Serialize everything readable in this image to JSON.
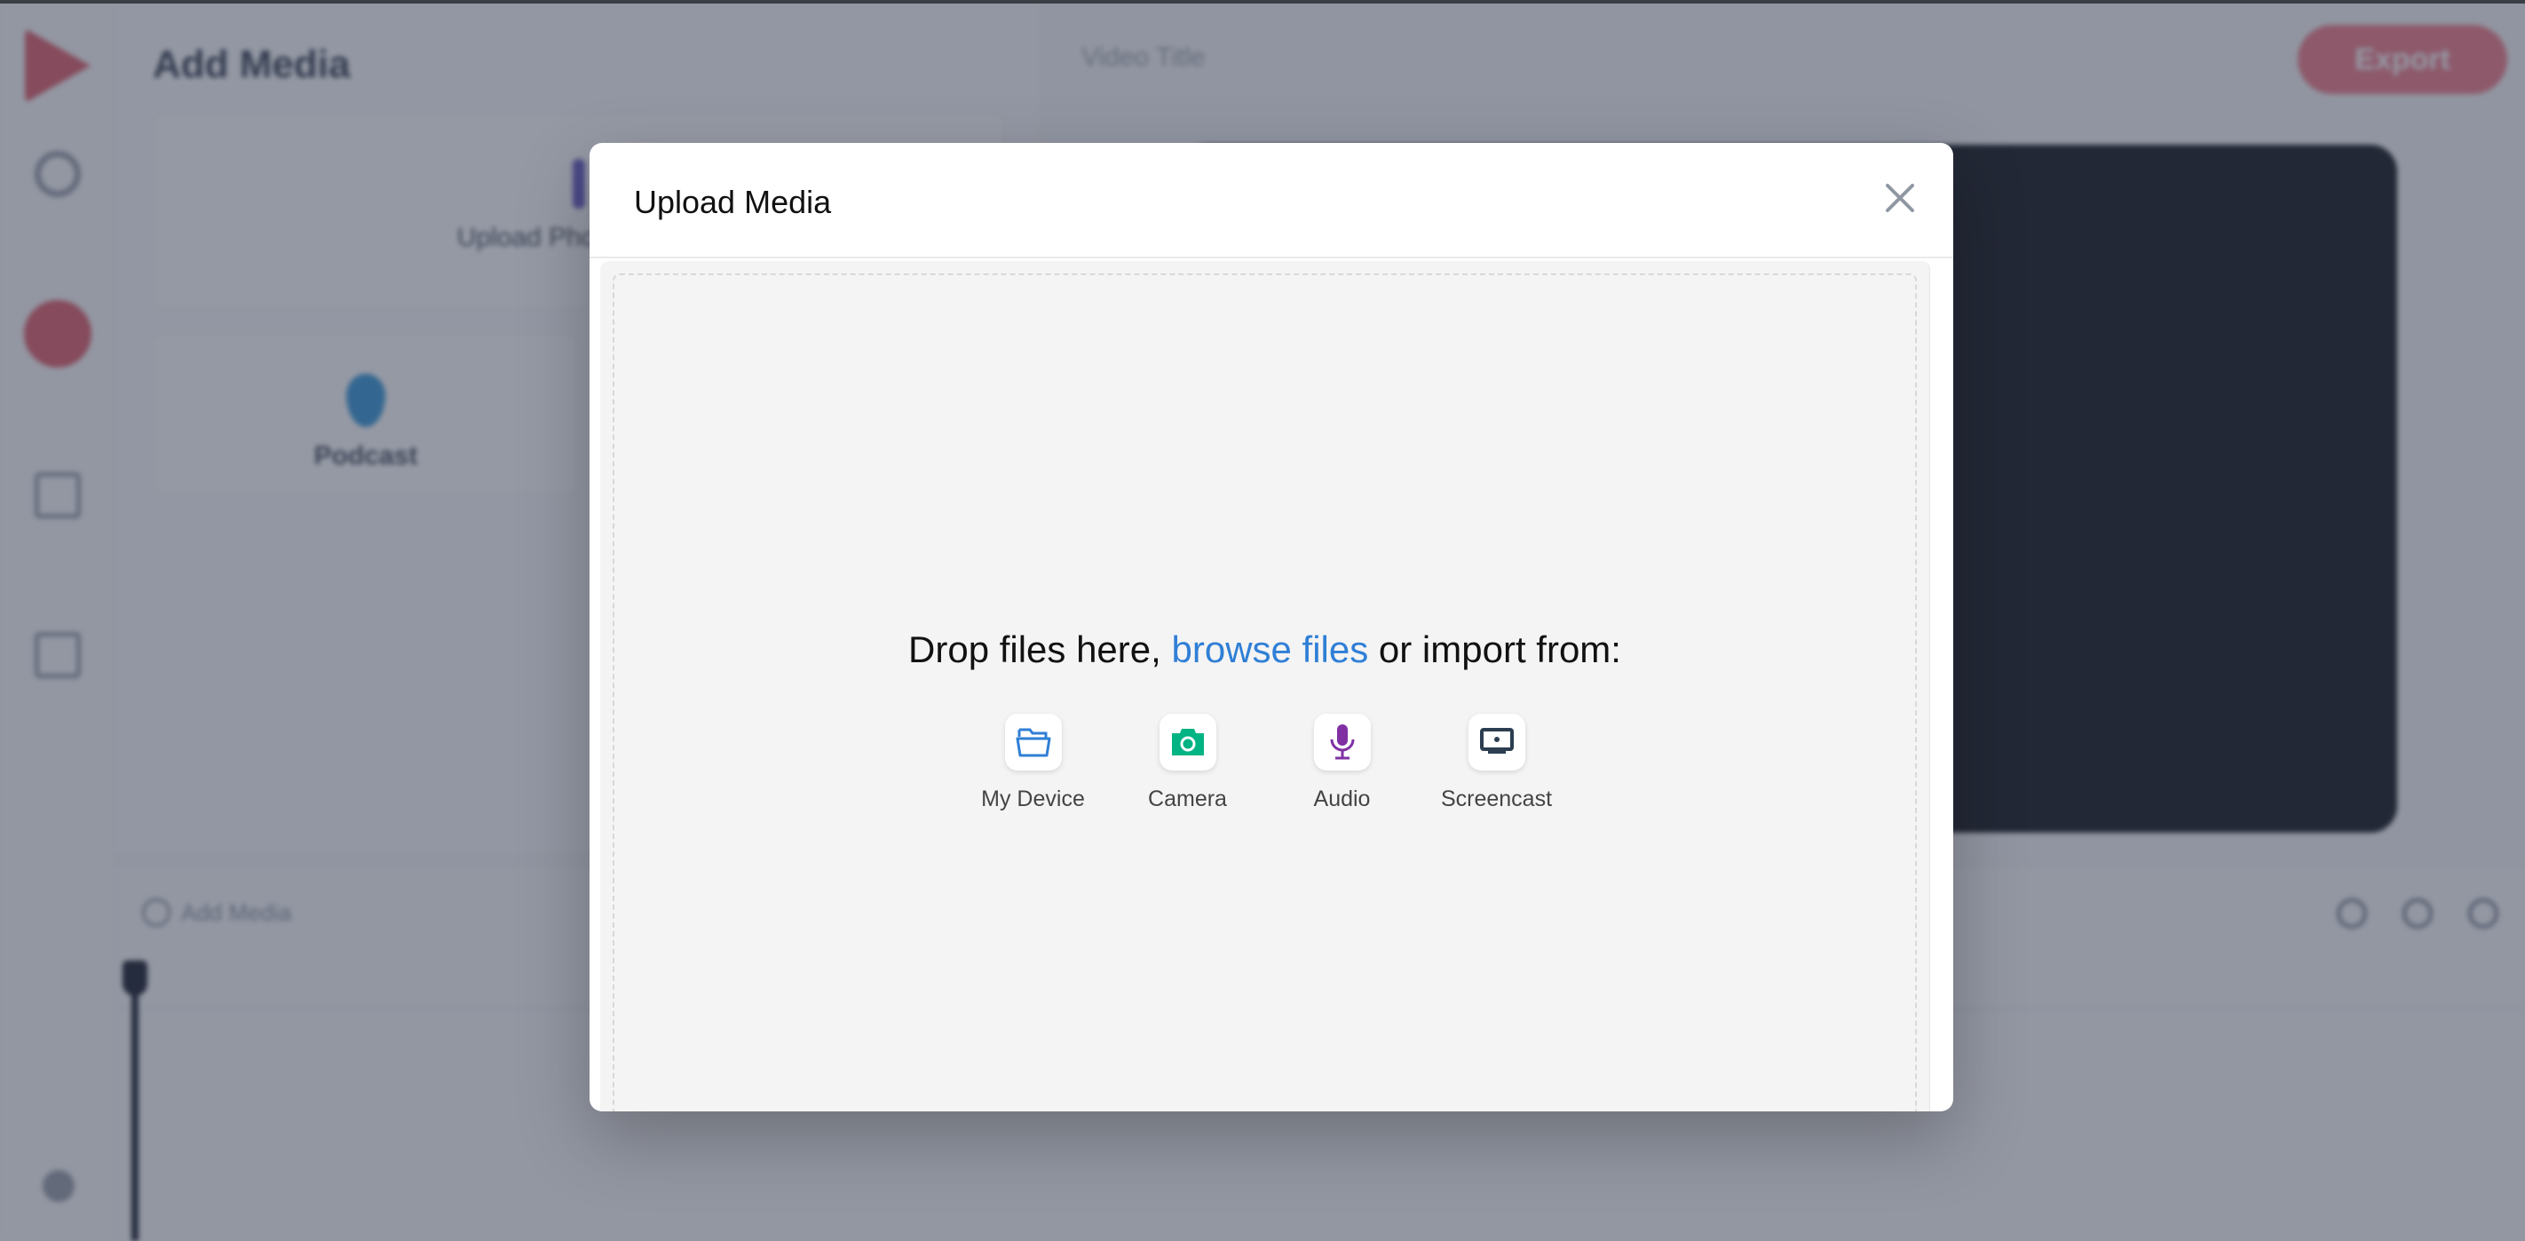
{
  "background": {
    "panel_title": "Add Media",
    "cards": [
      {
        "label": "Upload Photo, Video"
      },
      {
        "label": "Podcast"
      }
    ],
    "video_title": "Video Title",
    "export_label": "Export",
    "timeline": {
      "add_media_label": "Add Media",
      "tools": [
        "zoom-out-icon",
        "zoom-in-icon",
        "fit-icon"
      ]
    }
  },
  "modal": {
    "title": "Upload Media",
    "close_icon": "close-icon",
    "drop_prefix": "Drop files here, ",
    "browse_link": "browse files",
    "drop_suffix": " or import from:",
    "sources": [
      {
        "label": "My Device",
        "icon": "folder-icon",
        "color": "#2f7fd6"
      },
      {
        "label": "Camera",
        "icon": "camera-icon",
        "color": "#02b383"
      },
      {
        "label": "Audio",
        "icon": "microphone-icon",
        "color": "#8030a3"
      },
      {
        "label": "Screencast",
        "icon": "screencast-icon",
        "color": "#2c3e50"
      }
    ]
  }
}
